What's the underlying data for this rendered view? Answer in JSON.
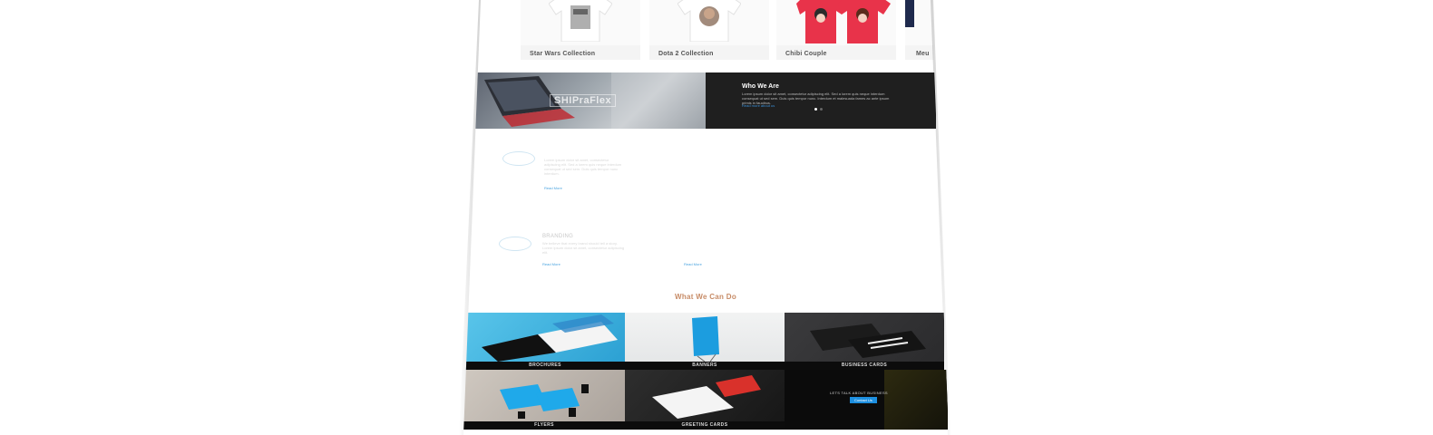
{
  "products": [
    {
      "label": "Star Wars Collection",
      "shirt_color": "#ffffff"
    },
    {
      "label": "Dota 2 Collection",
      "shirt_color": "#ffffff"
    },
    {
      "label": "Chibi Couple",
      "shirt_color": "#e8334a"
    },
    {
      "label": "Meu",
      "shirt_color": "#1f2a4d"
    }
  ],
  "who": {
    "title": "Who We Are",
    "text": "Lorem ipsum dolor sit amet, consectetur adipiscing elit. Sed a lorem quis neque interdum consequat ut sed sem. Duis quis tempor nunc. Interdum et malesuada fames ac ante ipsum primis in faucibus.",
    "link": "Read more about us",
    "watermark": "SHIPraFlex"
  },
  "services": {
    "text1": "Lorem ipsum dolor sit amet, consectetur adipiscing elit. Sed a lorem quis neque interdum consequat ut sed sem. Duis quis tempor nunc interdum.",
    "link1": "Read More",
    "heading2": "BRANDING",
    "text2": "We believe that every brand should tell a story. Lorem ipsum dolor sit amet, consectetur adipiscing elit.",
    "link2": "Read More",
    "link3": "Read More"
  },
  "section_title": "What We Can Do",
  "tiles": [
    {
      "caption": "BROCHURES"
    },
    {
      "caption": "BANNERS"
    },
    {
      "caption": "BUSINESS CARDS"
    },
    {
      "caption": "FLYERS"
    },
    {
      "caption": "GREETING CARDS"
    },
    {
      "caption": "",
      "lets_talk": "LETS TALK ABOUT BUSINESS",
      "button": "Contact Us"
    }
  ],
  "colors": {
    "accent": "#1d8fe0",
    "heading": "#c78b66",
    "dark": "#1f1f1f"
  }
}
